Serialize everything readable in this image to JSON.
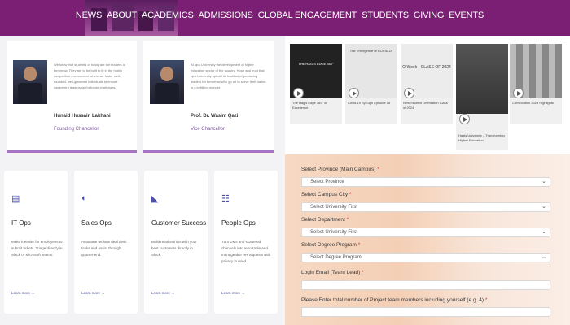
{
  "nav": {
    "items": [
      "NEWS",
      "ABOUT",
      "ACADEMICS",
      "ADMISSIONS",
      "GLOBAL ENGAGEMENT",
      "STUDENTS",
      "GIVING",
      "EVENTS"
    ]
  },
  "people": [
    {
      "quote": "We know that students of today are the leaders of tomorrow. They are to be built to fit in the highly competitive environment where we foster well-rounded, well-groomed individuals to ensure competent leadership for future challenges.",
      "name": "Hunaid Hussain Lakhani",
      "role": "Founding Chancellor"
    },
    {
      "quote": "At Iqra University the development of higher education sector of the country. Hope and trust that Iqra University uphold its tradition of producing leaders for tomorrow who go on to serve their nation in a befitting manner.",
      "name": "Prof. Dr. Wasim Qazi",
      "role": "Vice Chancellor"
    }
  ],
  "ops_cards": [
    {
      "icon": "document-icon",
      "title": "IT Ops",
      "desc": "Make it easier for employees to submit tickets. Triage directly in Slack or Microsoft Teams.",
      "more": "Learn more →"
    },
    {
      "icon": "dollar-icon",
      "title": "Sales Ops",
      "desc": "Automate tedious deal desk tasks and assist through quarter-end.",
      "more": "Learn more →"
    },
    {
      "icon": "flag-icon",
      "title": "Customer Success",
      "desc": "Build relationships with your best customers directly in Slack.",
      "more": "Learn more →"
    },
    {
      "icon": "people-icon",
      "title": "People Ops",
      "desc": "Turn DMs and scattered channels into reportable and manageable HR requests with privacy in mind.",
      "more": "Learn more →"
    }
  ],
  "videos": [
    {
      "thumb_text": "THE HAGIS EDGE 360°",
      "caption": "The Hagis Edge 360° of Excellence"
    },
    {
      "thumb_text": "The Emergence of COVID-19",
      "caption": "Covid-19 Sy-Sign Episode 16"
    },
    {
      "thumb_text": "O Week · CLASS OF 2024",
      "caption": "New Student Orientation Class of 2024"
    },
    {
      "thumb_text": "",
      "caption": "Hagis University – Transforming Higher Education"
    },
    {
      "thumb_text": "",
      "caption": "Convocation 2023 Highlights"
    }
  ],
  "form": {
    "fields": [
      {
        "label": "Select Province (Main Campus)",
        "placeholder": "Select Province"
      },
      {
        "label": "Select Campus City",
        "placeholder": "Select University First"
      },
      {
        "label": "Select Department",
        "placeholder": "Select University First"
      },
      {
        "label": "Select Degree Program",
        "placeholder": "Select Degree Program"
      }
    ],
    "email_label": "Login Email (Team Lead)",
    "members_label": "Please Enter total number of Project team members including yourself (e.g. 4)",
    "required_mark": "*"
  }
}
